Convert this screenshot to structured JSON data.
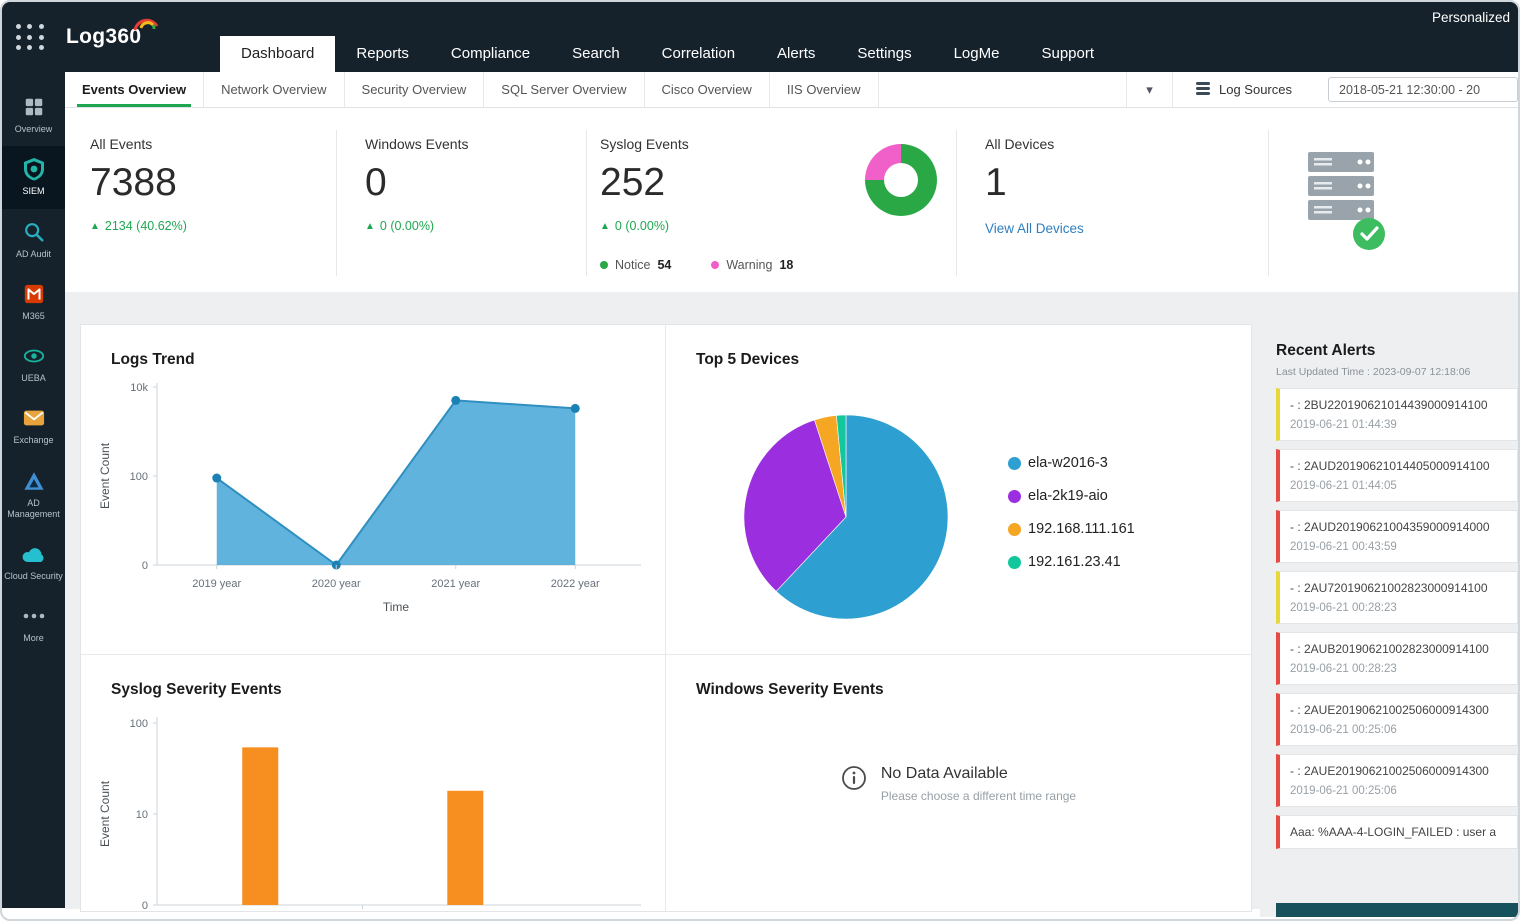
{
  "icons": {
    "up_triangle": "▲",
    "dropdown_arrow": "▾"
  },
  "topbar": {
    "logo_text": "Log360",
    "personalized_label": "Personalized",
    "nav_items": [
      {
        "label": "Dashboard",
        "active": true
      },
      {
        "label": "Reports",
        "active": false
      },
      {
        "label": "Compliance",
        "active": false
      },
      {
        "label": "Search",
        "active": false
      },
      {
        "label": "Correlation",
        "active": false
      },
      {
        "label": "Alerts",
        "active": false
      },
      {
        "label": "Settings",
        "active": false
      },
      {
        "label": "LogMe",
        "active": false
      },
      {
        "label": "Support",
        "active": false
      }
    ]
  },
  "sidebar": {
    "items": [
      {
        "label": "Overview",
        "icon": "grid-icon",
        "active": false,
        "color": "#aeb9c1"
      },
      {
        "label": "SIEM",
        "icon": "shield-icon",
        "active": true,
        "color": "#21b6a8"
      },
      {
        "label": "AD Audit",
        "icon": "audit-icon",
        "active": false,
        "color": "#27aebe"
      },
      {
        "label": "M365",
        "icon": "m365-icon",
        "active": false,
        "color": "#d83b01"
      },
      {
        "label": "UEBA",
        "icon": "eye-icon",
        "active": false,
        "color": "#18b59d"
      },
      {
        "label": "Exchange",
        "icon": "exchange-icon",
        "active": false,
        "color": "#e8a33d"
      },
      {
        "label": "AD Management",
        "icon": "ad-management-icon",
        "active": false,
        "color": "#3f8fd2"
      },
      {
        "label": "Cloud Security",
        "icon": "cloud-security-icon",
        "active": false,
        "color": "#26bfd0"
      },
      {
        "label": "More",
        "icon": "more-icon",
        "active": false,
        "color": "#aeb9c1"
      }
    ]
  },
  "subtabs": {
    "items": [
      {
        "label": "Events Overview",
        "active": true
      },
      {
        "label": "Network Overview",
        "active": false
      },
      {
        "label": "Security Overview",
        "active": false
      },
      {
        "label": "SQL Server Overview",
        "active": false
      },
      {
        "label": "Cisco Overview",
        "active": false
      },
      {
        "label": "IIS Overview",
        "active": false
      }
    ],
    "log_sources_label": "Log Sources",
    "date_range_value": "2018-05-21 12:30:00 - 20"
  },
  "stats": {
    "all_events": {
      "label": "All Events",
      "value": "7388",
      "delta": "2134 (40.62%)"
    },
    "windows_events": {
      "label": "Windows Events",
      "value": "0",
      "delta": "0 (0.00%)"
    },
    "syslog_events": {
      "label": "Syslog Events",
      "value": "252",
      "delta": "0 (0.00%)",
      "donut_segments": [
        {
          "label": "Notice",
          "value": 54,
          "color": "#2aa845"
        },
        {
          "label": "Warning",
          "value": 18,
          "color": "#f060c8"
        }
      ]
    },
    "all_devices": {
      "label": "All Devices",
      "value": "1",
      "link_label": "View All Devices"
    }
  },
  "alerts": {
    "title": "Recent Alerts",
    "last_updated": "Last Updated Time : 2023-09-07 12:18:06",
    "items": [
      {
        "text": "- : 2BU220190621014439000914100",
        "time": "2019-06-21 01:44:39",
        "severity_color": "#e5d838"
      },
      {
        "text": "- : 2AUD20190621014405000914100",
        "time": "2019-06-21 01:44:05",
        "severity_color": "#e74a42"
      },
      {
        "text": "- : 2AUD20190621004359000914000",
        "time": "2019-06-21 00:43:59",
        "severity_color": "#e74a42"
      },
      {
        "text": "- : 2AU720190621002823000914100",
        "time": "2019-06-21 00:28:23",
        "severity_color": "#e5d838"
      },
      {
        "text": "- : 2AUB20190621002823000914100",
        "time": "2019-06-21 00:28:23",
        "severity_color": "#e74a42"
      },
      {
        "text": "- : 2AUE20190621002506000914300",
        "time": "2019-06-21 00:25:06",
        "severity_color": "#e74a42"
      },
      {
        "text": "- : 2AUE20190621002506000914300",
        "time": "2019-06-21 00:25:06",
        "severity_color": "#e74a42"
      },
      {
        "text": "Aaa: %AAA-4-LOGIN_FAILED : user a",
        "time": "",
        "severity_color": "#e74a42"
      }
    ]
  },
  "chart_data": [
    {
      "type": "area",
      "title": "Logs Trend",
      "x": [
        "2019 year",
        "2020 year",
        "2021 year",
        "2022 year"
      ],
      "values": [
        90,
        0,
        5000,
        3300
      ],
      "xlabel": "Time",
      "ylabel": "Event Count",
      "yscale": "log",
      "yticks": [
        0,
        100,
        10000
      ],
      "ytick_labels": [
        "0",
        "100",
        "10k"
      ],
      "color": "#4aa8d8",
      "line_color": "#2e8fc0",
      "dot_color": "#1b80b4"
    },
    {
      "type": "pie",
      "title": "Top 5 Devices",
      "labels": [
        "ela-w2016-3",
        "ela-2k19-aio",
        "192.168.111.161",
        "192.161.23.41"
      ],
      "values": [
        62,
        33,
        3.5,
        1.5
      ],
      "colors": [
        "#2d9fd0",
        "#9b2fe0",
        "#f5a623",
        "#12c79b"
      ],
      "legend_position": "right"
    },
    {
      "type": "bar",
      "title": "Syslog Severity Events",
      "categories": [
        "",
        ""
      ],
      "values": [
        54,
        18
      ],
      "ylabel": "Event Count",
      "yscale": "log",
      "yticks": [
        0,
        10,
        100
      ],
      "ytick_labels": [
        "0",
        "10",
        "100"
      ],
      "color": "#f78f20"
    },
    {
      "type": "empty",
      "title": "Windows Severity Events",
      "message": "No Data Available",
      "submessage": "Please choose a different time range"
    }
  ]
}
